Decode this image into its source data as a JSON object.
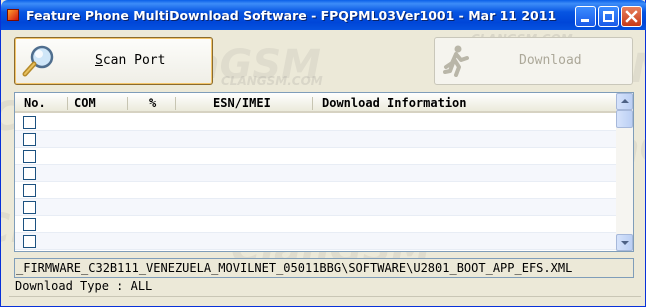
{
  "window": {
    "title": "Feature Phone MultiDownload Software - FPQPML03Ver1001 - Mar 11 2011",
    "icon": "app-icon",
    "controls": {
      "minimize_icon": "minimize-icon",
      "maximize_icon": "maximize-icon",
      "close_icon": "close-icon"
    }
  },
  "toolbar": {
    "scan_button": {
      "mnemonic": "S",
      "rest": "can Port",
      "icon": "magnifier-icon"
    },
    "download_button": {
      "label": "Download",
      "icon": "running-man-icon",
      "enabled": false
    }
  },
  "port_list": {
    "columns": [
      "No.",
      "COM",
      "%",
      "ESN/IMEI",
      "Download Information"
    ],
    "rows": [
      {
        "checked": false
      },
      {
        "checked": false
      },
      {
        "checked": false
      },
      {
        "checked": false
      },
      {
        "checked": false
      },
      {
        "checked": false
      },
      {
        "checked": false
      },
      {
        "checked": false
      }
    ]
  },
  "status": {
    "file_path": "_FIRMWARE_C32B111_VENEZUELA_MOVILNET_05011BBG\\SOFTWARE\\U2801_BOOT_APP_EFS.XML",
    "download_type": "Download Type : ALL"
  },
  "watermark": {
    "big": "ClanGSM",
    "small": "CLANGSM.COM",
    "tag": "CLANGSM"
  },
  "colors": {
    "titlebar": "#0054E3",
    "window_bg": "#ECE9D8",
    "scan_border": "#F4C66B",
    "disabled_text": "#ACA899"
  }
}
